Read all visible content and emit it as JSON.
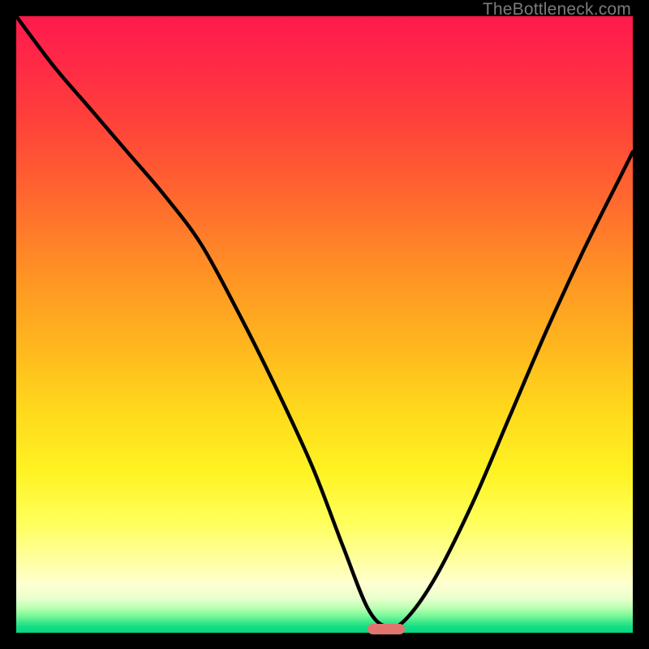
{
  "watermark": "TheBottleneck.com",
  "colors": {
    "frame": "#000000",
    "curve": "#000000",
    "saddle": "#e0746f",
    "watermark": "#7b7b7b"
  },
  "chart_data": {
    "type": "line",
    "title": "",
    "xlabel": "",
    "ylabel": "",
    "xlim": [
      0,
      100
    ],
    "ylim": [
      0,
      100
    ],
    "grid": false,
    "legend": false,
    "series": [
      {
        "name": "bottleneck-curve",
        "x": [
          0,
          6,
          12,
          18,
          24,
          30,
          36,
          42,
          48,
          53,
          57,
          60,
          63,
          68,
          74,
          80,
          86,
          92,
          98,
          100
        ],
        "values": [
          100,
          92,
          85,
          78,
          71,
          63,
          52,
          40,
          27,
          14,
          4,
          1,
          2,
          9,
          21,
          35,
          49,
          62,
          74,
          78
        ]
      }
    ],
    "marker": {
      "name": "optimal-range",
      "x_range": [
        57,
        63
      ],
      "y": 0.6
    },
    "background_gradient": [
      {
        "pos": 0.0,
        "color": "#ff1a4d"
      },
      {
        "pos": 0.3,
        "color": "#ff6a2e"
      },
      {
        "pos": 0.64,
        "color": "#ffd91c"
      },
      {
        "pos": 0.88,
        "color": "#ffff9e"
      },
      {
        "pos": 1.0,
        "color": "#06d680"
      }
    ]
  }
}
